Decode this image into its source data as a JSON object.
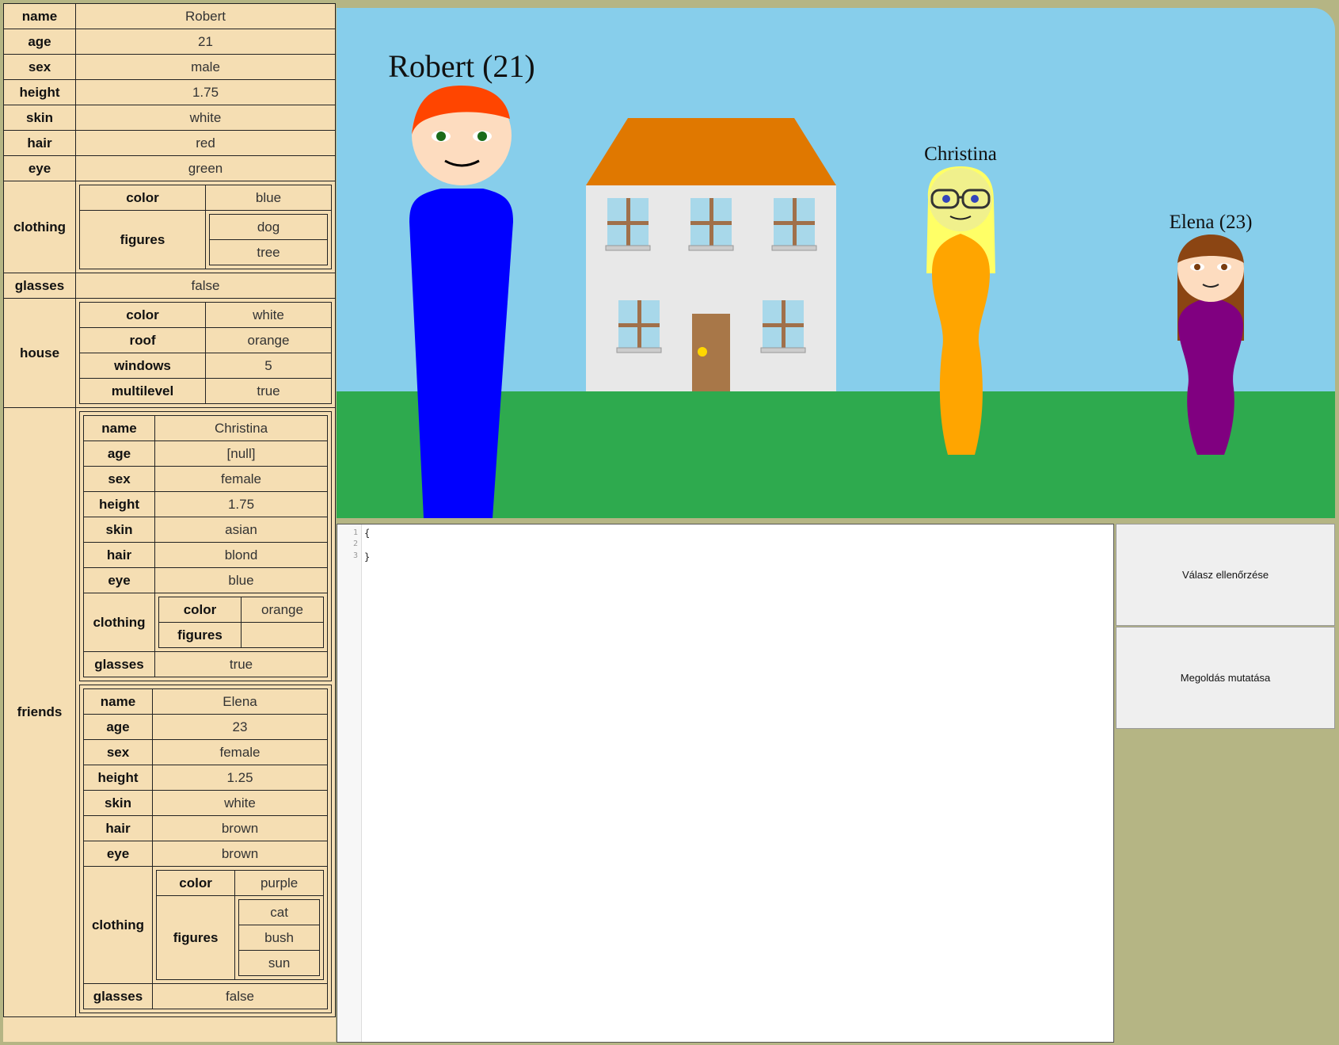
{
  "person": {
    "labels": {
      "name": "name",
      "age": "age",
      "sex": "sex",
      "height": "height",
      "skin": "skin",
      "hair": "hair",
      "eye": "eye",
      "clothing": "clothing",
      "color": "color",
      "figures": "figures",
      "glasses": "glasses",
      "house": "house",
      "roof": "roof",
      "windows": "windows",
      "multilevel": "multilevel",
      "friends": "friends"
    },
    "name": "Robert",
    "age": "21",
    "sex": "male",
    "height": "1.75",
    "skin": "white",
    "hair": "red",
    "eye": "green",
    "clothing": {
      "color": "blue",
      "figures": [
        "dog",
        "tree"
      ]
    },
    "glasses": "false",
    "house": {
      "color": "white",
      "roof": "orange",
      "windows": "5",
      "multilevel": "true"
    },
    "friends": [
      {
        "name": "Christina",
        "age": "[null]",
        "sex": "female",
        "height": "1.75",
        "skin": "asian",
        "hair": "blond",
        "eye": "blue",
        "clothing": {
          "color": "orange",
          "figures": []
        },
        "glasses": "true"
      },
      {
        "name": "Elena",
        "age": "23",
        "sex": "female",
        "height": "1.25",
        "skin": "white",
        "hair": "brown",
        "eye": "brown",
        "clothing": {
          "color": "purple",
          "figures": [
            "cat",
            "bush",
            "sun"
          ]
        },
        "glasses": "false"
      }
    ]
  },
  "scene": {
    "labels": {
      "robert": "Robert (21)",
      "christina": "Christina",
      "elena": "Elena (23)"
    },
    "colors": {
      "sky": "#87ceeb",
      "grass": "#2eaa4e",
      "skin": "#fddcbf",
      "robert_hair": "#ff4500",
      "robert_shirt": "#0000ff",
      "house": "#e8e8e8",
      "roof": "#e07800",
      "door": "#a87748",
      "christina_hair": "#ffff66",
      "christina_dress": "#ffa500",
      "elena_hair": "#8b4513",
      "elena_dress": "#800080"
    }
  },
  "editor": {
    "lines": [
      "{",
      "",
      "}"
    ],
    "line_numbers": [
      "1",
      "2",
      "3"
    ]
  },
  "buttons": {
    "check": "Válasz ellenőrzése",
    "solution": "Megoldás mutatása"
  }
}
